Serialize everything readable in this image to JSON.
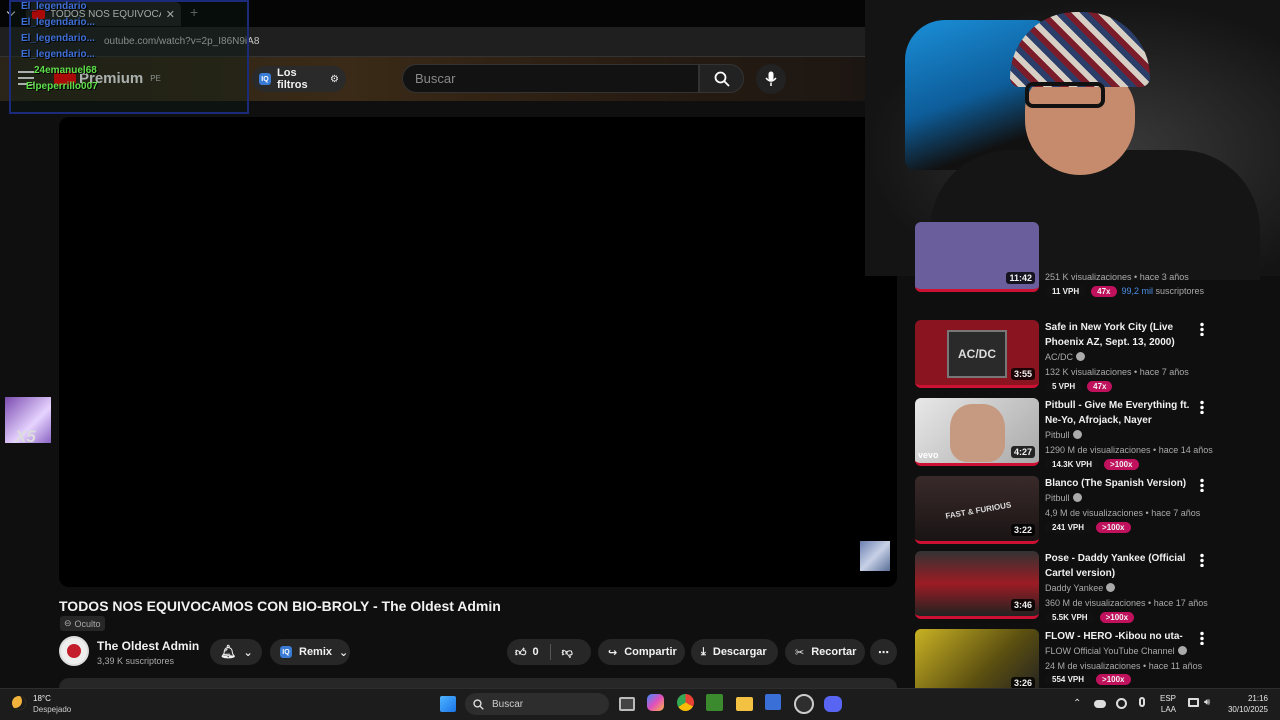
{
  "browser": {
    "tab_title": "TODOS NOS EQUIVOCAMOS C",
    "url": "outube.com/watch?v=2p_I86N9iA8"
  },
  "header": {
    "logo_text": "Premium",
    "country": "PE",
    "filters_label": "Los filtros",
    "search_placeholder": "Buscar"
  },
  "chat_overlay": {
    "lines": [
      "El_legendario",
      "El_legendario...",
      "El_legendario...",
      "El_legendario...",
      "24emanuel68",
      "Elpeperrillo007"
    ]
  },
  "side_badge": "X5",
  "video": {
    "title": "TODOS NOS EQUIVOCAMOS CON BIO-BROLY - The Oldest Admin",
    "visibility": "Oculto",
    "channel": "The Oldest Admin",
    "subscribers": "3,39 K suscriptores",
    "remix_label": "Remix",
    "likes": "0",
    "share_label": "Compartir",
    "download_label": "Descargar",
    "clip_label": "Recortar"
  },
  "recommendations": [
    {
      "title": "",
      "channel": "",
      "meta": "251 K visualizaciones • hace 3 años",
      "duration": "11:42",
      "vph": "11 VPH",
      "mult": "47x",
      "extra_value": "99,2 mil",
      "extra_suffix": "suscriptores",
      "color": "#6a5f9c"
    },
    {
      "title": "Safe in New York City (Live Phoenix AZ, Sept. 13, 2000)",
      "channel": "AC/DC",
      "meta": "132 K visualizaciones • hace 7 años",
      "duration": "3:55",
      "vph": "5 VPH",
      "mult": "47x",
      "thumb_text": "AC/DC",
      "color": "#8a1420"
    },
    {
      "title": "Pitbull - Give Me Everything ft. Ne-Yo, Afrojack, Nayer",
      "channel": "Pitbull",
      "meta": "1290 M de visualizaciones • hace 14 años",
      "duration": "4:27",
      "vph": "14.3K VPH",
      "mult": ">100x",
      "thumb_text": "vevo",
      "color": "#c9c9c9"
    },
    {
      "title": "Blanco (The Spanish Version)",
      "channel": "Pitbull",
      "meta": "4,9 M de visualizaciones • hace 7 años",
      "duration": "3:22",
      "vph": "241 VPH",
      "mult": ">100x",
      "thumb_text": "FAST & FURIOUS",
      "color": "#3a2a2a"
    },
    {
      "title": "Pose - Daddy Yankee (Official Cartel version)",
      "channel": "Daddy Yankee",
      "meta": "360 M de visualizaciones • hace 17 años",
      "duration": "3:46",
      "vph": "5.5K VPH",
      "mult": ">100x",
      "thumb_text": "",
      "color": "#9c1c24"
    },
    {
      "title": "FLOW - HERO -Kibou no uta-",
      "channel": "FLOW Official YouTube Channel",
      "meta": "24 M de visualizaciones • hace 11 años",
      "duration": "3:26",
      "vph": "554 VPH",
      "mult": ">100x",
      "thumb_text": "",
      "color": "#8a7a18"
    }
  ],
  "taskbar": {
    "weather_temp": "18°C",
    "weather_desc": "Despejado",
    "search_label": "Buscar",
    "lang_top": "ESP",
    "lang_bottom": "LAA",
    "time": "21:16",
    "date": "30/10/2025"
  }
}
